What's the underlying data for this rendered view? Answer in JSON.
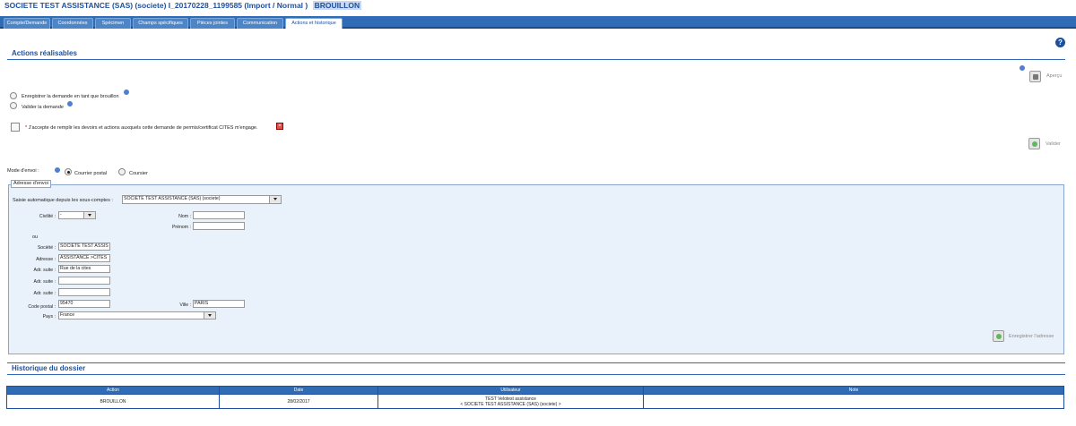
{
  "header": {
    "title": "SOCIETE TEST ASSISTANCE (SAS) (societe)  I_20170228_1199585 (Import / Normal )",
    "status": "BROUILLON"
  },
  "tabs": [
    {
      "label": "Compte/Demande"
    },
    {
      "label": "Coordonnées"
    },
    {
      "label": "Spécimen"
    },
    {
      "label": "Champs spécifiques"
    },
    {
      "label": "Pièces jointes"
    },
    {
      "label": "Communication"
    },
    {
      "label": "Actions et historique"
    }
  ],
  "actions": {
    "heading": "Actions réalisables",
    "apercu_label": "Aperçu",
    "option_brouillon": "Enregistrer la demande en tant que brouillon",
    "option_valider": "Valider la demande",
    "accept_text": "J'accepte de remplir les devoirs et actions auxquels cette demande de permis/certificat CITES m'engage.",
    "required_mark": "*",
    "valider_label": "Valider",
    "mode_label": "Mode d'envoi :",
    "mode_courrier_postal": "Courrier postal",
    "mode_coursier": "Coursier"
  },
  "adresse": {
    "legend": "Adresse d'envoi",
    "auto_label": "Saisie automatique depuis les sous-comptes :",
    "auto_value": "SOCIETE TEST ASSISTANCE (SAS) (societe)",
    "civilite_label": "Civilité :",
    "civilite_value": "-",
    "nom_label": "Nom :",
    "nom_value": "",
    "prenom_label": "Prénom :",
    "prenom_value": "",
    "ou": "ou",
    "societe_label": "Société :",
    "societe_value": "SOCIETE TEST ASSIS",
    "adresse_label": "Adresse :",
    "adresse_value": "ASSISTANCE >CITES",
    "adr_suite_label": "Adr. suite :",
    "adr_suite1_value": "Rue de la cites",
    "adr_suite2_value": "",
    "adr_suite3_value": "",
    "adr_suite4_value": "",
    "code_postal_label": "Code postal :",
    "code_postal_value": "95470",
    "ville_label": "Ville :",
    "ville_value": "PARIS",
    "pays_label": "Pays :",
    "pays_value": "France",
    "save_label": "Enregistrer l'adresse"
  },
  "historique": {
    "heading": "Historique du dossier",
    "columns": [
      "Action",
      "Date",
      "Utilisateur",
      "Note"
    ],
    "rows": [
      {
        "action": "BROUILLON",
        "date": "28/02/2017",
        "user_line1": "TEST Velotest assistance",
        "user_line2": "< SOCIETE TEST ASSISTANCE (SAS) (societe) >",
        "note": ""
      }
    ]
  },
  "colors": {
    "accent": "#2f6cb5",
    "title": "#1e4f9c",
    "panel": "#e9f2fb"
  }
}
